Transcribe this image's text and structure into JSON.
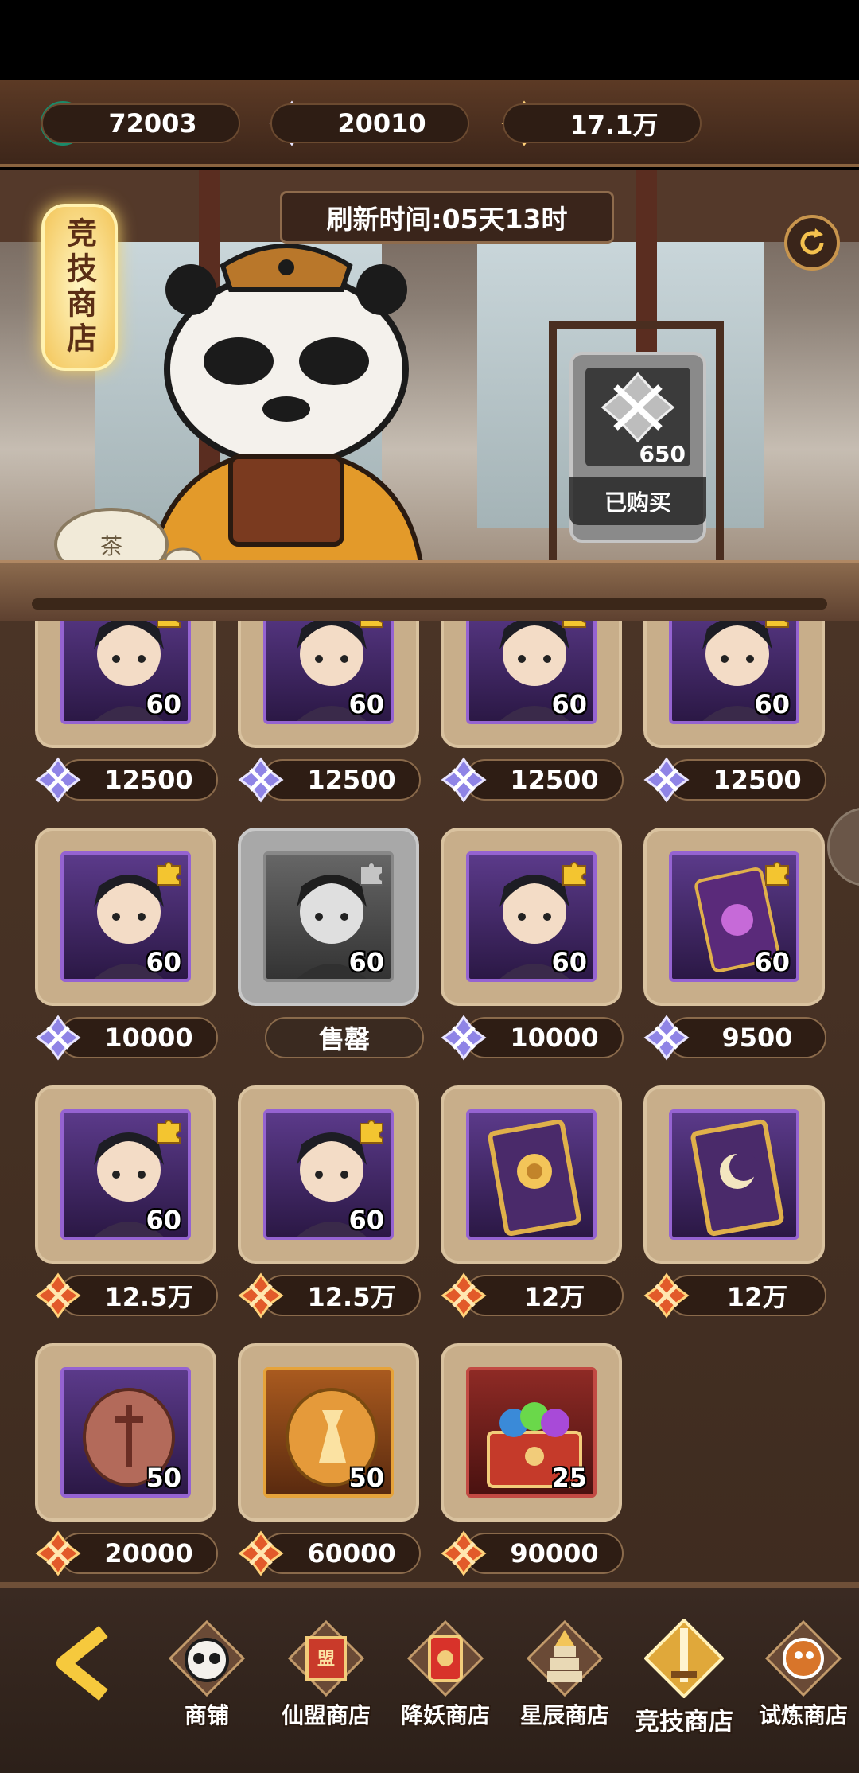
{
  "currencies": [
    {
      "icon": "jade-coin-icon",
      "value": "72003"
    },
    {
      "icon": "arena-crystal-icon",
      "value": "20010"
    },
    {
      "icon": "red-gem-icon",
      "value": "17.1万"
    }
  ],
  "banner": {
    "shop_name": "竞技商店",
    "refresh_text": "刷新时间:05天13时",
    "featured": {
      "count": "650",
      "status": "已购买"
    }
  },
  "items": [
    {
      "count": "60",
      "price": "12500",
      "currency": "arena-crystal",
      "fragment": true,
      "art": "hero-a"
    },
    {
      "count": "60",
      "price": "12500",
      "currency": "arena-crystal",
      "fragment": true,
      "art": "hero-b"
    },
    {
      "count": "60",
      "price": "12500",
      "currency": "arena-crystal",
      "fragment": true,
      "art": "hero-c"
    },
    {
      "count": "60",
      "price": "12500",
      "currency": "arena-crystal",
      "fragment": true,
      "art": "hero-d"
    },
    {
      "count": "60",
      "price": "10000",
      "currency": "arena-crystal",
      "fragment": true,
      "art": "hero-e"
    },
    {
      "count": "60",
      "price": "售罄",
      "currency": "none",
      "fragment": true,
      "art": "hero-f",
      "sold_out": true
    },
    {
      "count": "60",
      "price": "10000",
      "currency": "arena-crystal",
      "fragment": true,
      "art": "hero-g"
    },
    {
      "count": "60",
      "price": "9500",
      "currency": "arena-crystal",
      "fragment": true,
      "art": "artifact-a"
    },
    {
      "count": "60",
      "price": "12.5万",
      "currency": "red-gem",
      "fragment": true,
      "art": "hero-h"
    },
    {
      "count": "60",
      "price": "12.5万",
      "currency": "red-gem",
      "fragment": true,
      "art": "hero-i"
    },
    {
      "count": "",
      "price": "12万",
      "currency": "red-gem",
      "fragment": false,
      "art": "sun-card"
    },
    {
      "count": "",
      "price": "12万",
      "currency": "red-gem",
      "fragment": false,
      "art": "moon-card"
    },
    {
      "count": "50",
      "price": "20000",
      "currency": "red-gem",
      "fragment": false,
      "art": "bronze-token"
    },
    {
      "count": "50",
      "price": "60000",
      "currency": "red-gem",
      "fragment": false,
      "art": "gold-token"
    },
    {
      "count": "25",
      "price": "90000",
      "currency": "red-gem",
      "fragment": false,
      "art": "gem-chest"
    }
  ],
  "nav": [
    {
      "label": "商铺",
      "icon": "panda-shop-icon"
    },
    {
      "label": "仙盟商店",
      "icon": "alliance-shop-icon"
    },
    {
      "label": "降妖商店",
      "icon": "demon-shop-icon"
    },
    {
      "label": "星辰商店",
      "icon": "star-pagoda-icon"
    },
    {
      "label": "竞技商店",
      "icon": "arena-sword-icon",
      "active": true
    },
    {
      "label": "试炼商店",
      "icon": "trial-shop-icon"
    }
  ],
  "colors": {
    "frame": "#c8ae8a",
    "dark": "#2e1d14",
    "purple": "#9563d1",
    "gold": "#f3c559"
  }
}
